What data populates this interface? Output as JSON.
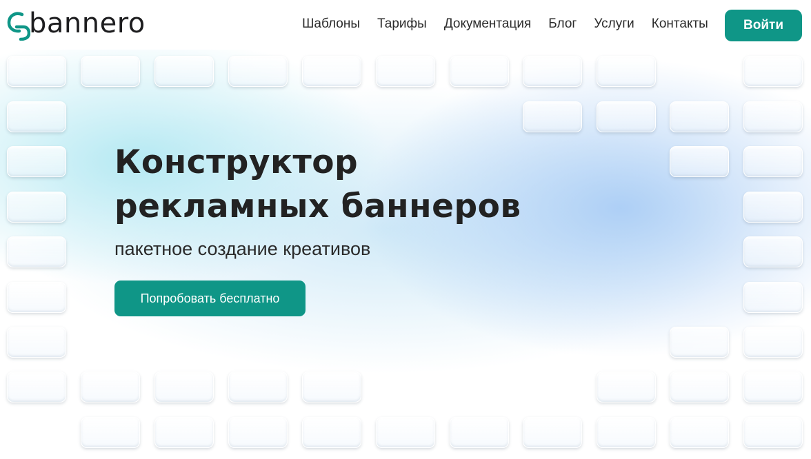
{
  "header": {
    "logo_text": "bannero",
    "nav": [
      "Шаблоны",
      "Тарифы",
      "Документация",
      "Блог",
      "Услуги",
      "Контакты"
    ],
    "login_label": "Войти"
  },
  "hero": {
    "title_line1": "Конструктор",
    "title_line2": "рекламных баннеров",
    "subtitle": "пакетное создание креативов",
    "cta_label": "Попробовать бесплатно"
  },
  "colors": {
    "accent": "#0f9687",
    "text": "#222222"
  }
}
